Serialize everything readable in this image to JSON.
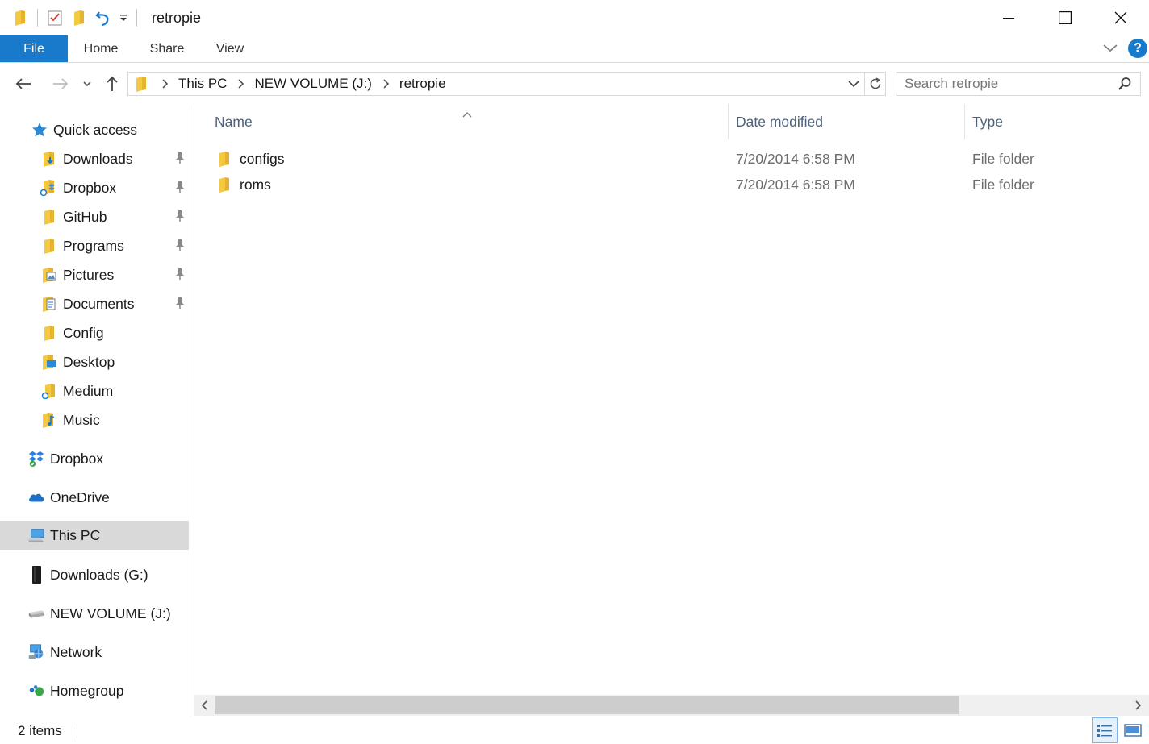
{
  "window": {
    "title": "retropie"
  },
  "ribbon": {
    "tabs": [
      {
        "label": "File"
      },
      {
        "label": "Home"
      },
      {
        "label": "Share"
      },
      {
        "label": "View"
      }
    ],
    "help_label": "?"
  },
  "address": {
    "crumbs": [
      "This PC",
      "NEW VOLUME (J:)",
      "retropie"
    ]
  },
  "search": {
    "placeholder": "Search retropie"
  },
  "sidebar": {
    "quick_access": {
      "label": "Quick access",
      "icon": "star-icon"
    },
    "quick_items": [
      {
        "label": "Downloads",
        "icon": "downloads-folder-icon",
        "pinned": true
      },
      {
        "label": "Dropbox",
        "icon": "dropbox-folder-icon",
        "pinned": true
      },
      {
        "label": "GitHub",
        "icon": "folder-icon",
        "pinned": true
      },
      {
        "label": "Programs",
        "icon": "folder-icon",
        "pinned": true
      },
      {
        "label": "Pictures",
        "icon": "pictures-folder-icon",
        "pinned": true
      },
      {
        "label": "Documents",
        "icon": "documents-folder-icon",
        "pinned": true
      },
      {
        "label": "Config",
        "icon": "folder-icon",
        "pinned": false
      },
      {
        "label": "Desktop",
        "icon": "desktop-folder-icon",
        "pinned": false
      },
      {
        "label": "Medium",
        "icon": "network-folder-icon",
        "pinned": false
      },
      {
        "label": "Music",
        "icon": "music-folder-icon",
        "pinned": false
      }
    ],
    "locations": [
      {
        "label": "Dropbox",
        "icon": "dropbox-icon"
      },
      {
        "label": "OneDrive",
        "icon": "onedrive-icon"
      },
      {
        "label": "This PC",
        "icon": "this-pc-icon",
        "selected": true
      },
      {
        "label": "Downloads (G:)",
        "icon": "external-drive-icon"
      },
      {
        "label": "NEW VOLUME (J:)",
        "icon": "usb-drive-icon"
      },
      {
        "label": "Network",
        "icon": "network-icon"
      },
      {
        "label": "Homegroup",
        "icon": "homegroup-icon"
      }
    ]
  },
  "columns": {
    "name": "Name",
    "date": "Date modified",
    "type": "Type"
  },
  "files": [
    {
      "name": "configs",
      "date": "7/20/2014 6:58 PM",
      "type": "File folder"
    },
    {
      "name": "roms",
      "date": "7/20/2014 6:58 PM",
      "type": "File folder"
    }
  ],
  "status": {
    "count": "2 items"
  },
  "colors": {
    "accent": "#1979ca",
    "folder": "#f5c842",
    "selected_bg": "#d9d9d9"
  }
}
